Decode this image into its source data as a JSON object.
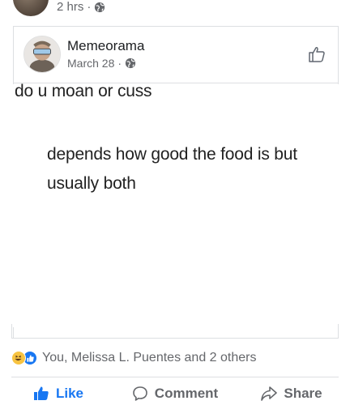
{
  "previous_post": {
    "time": "2 hrs",
    "separator": "·",
    "privacy_icon": "globe-icon"
  },
  "shared_post": {
    "author": "Memeorama",
    "date": "March 28",
    "separator": "·",
    "privacy_icon": "globe-icon",
    "like_page_icon": "thumbs-up-outline-icon"
  },
  "meme": {
    "line1": "do u moan or cuss",
    "line2": "depends how good the food is but usually both"
  },
  "reactions": {
    "icons": [
      "haha-icon",
      "like-icon"
    ],
    "summary": "You, Melissa L. Puentes and 2 others"
  },
  "actions": {
    "like": "Like",
    "comment": "Comment",
    "share": "Share"
  },
  "colors": {
    "like_active": "#1877f2",
    "meta_gray": "#65676b",
    "border": "#dddfe2"
  }
}
